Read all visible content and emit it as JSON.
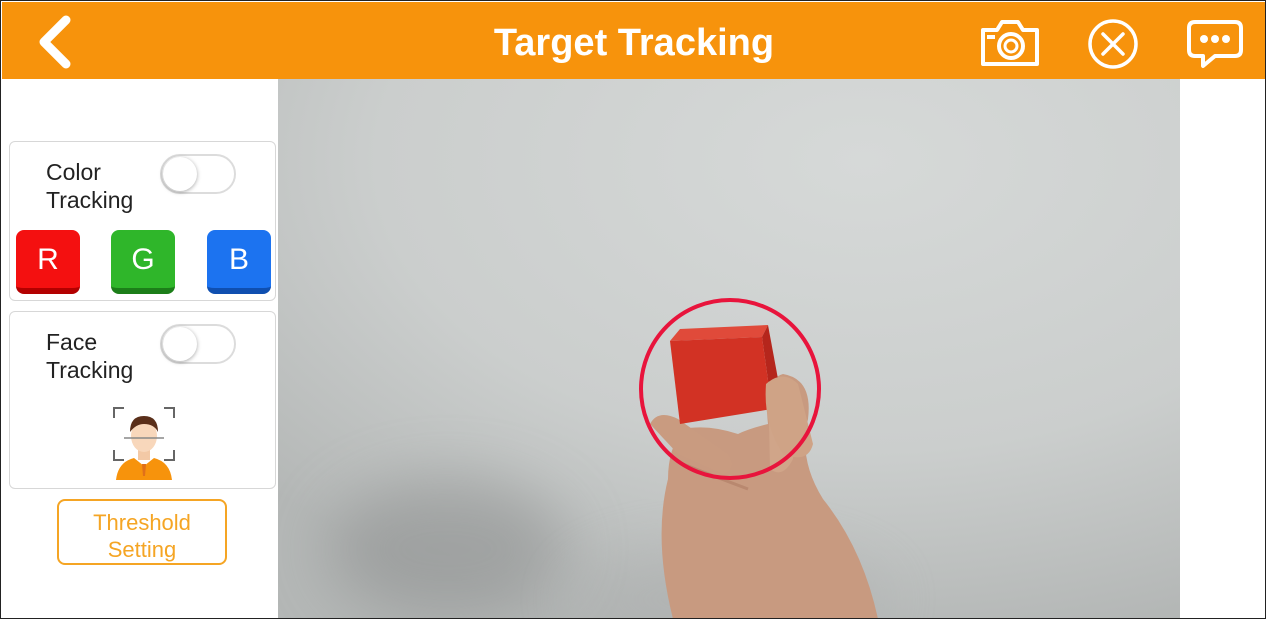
{
  "header": {
    "title": "Target Tracking",
    "back_icon": "chevron-left-icon",
    "camera_icon": "camera-icon",
    "close_icon": "close-circle-icon",
    "message_icon": "chat-bubble-icon"
  },
  "sidebar": {
    "color_tracking": {
      "label": "Color Tracking",
      "enabled": false,
      "buttons": [
        {
          "label": "R",
          "color": "#f41010"
        },
        {
          "label": "G",
          "color": "#2fb62a"
        },
        {
          "label": "B",
          "color": "#1c73f0"
        }
      ]
    },
    "face_tracking": {
      "label": "Face Tracking",
      "enabled": false,
      "icon": "face-scan-icon"
    },
    "threshold_button": "Threshold Setting"
  },
  "colors": {
    "header": "#f7930c",
    "accent": "#f5a524",
    "tracking_circle": "#e8143c"
  }
}
